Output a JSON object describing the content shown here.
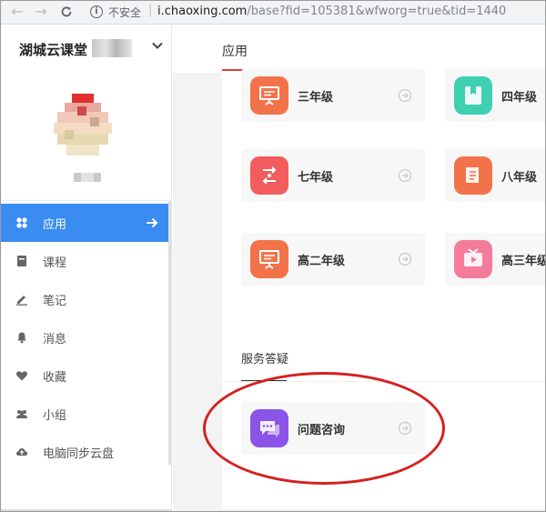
{
  "browser": {
    "security_label": "不安全",
    "separator": "|",
    "url_host": "i.chaoxing.com",
    "url_rest": "/base?fid=105381&wfworg=true&tid=1440"
  },
  "sidebar": {
    "title": "湖城云课堂",
    "menu": [
      {
        "label": "应用",
        "icon": "apps-icon",
        "active": true
      },
      {
        "label": "课程",
        "icon": "book-icon"
      },
      {
        "label": "笔记",
        "icon": "pen-icon"
      },
      {
        "label": "消息",
        "icon": "bell-icon"
      },
      {
        "label": "收藏",
        "icon": "heart-icon"
      },
      {
        "label": "小组",
        "icon": "group-icon"
      },
      {
        "label": "电脑同步云盘",
        "icon": "cloud-upload-icon"
      }
    ]
  },
  "main": {
    "tab_label": "应用",
    "apps": [
      {
        "label": "三年级",
        "icon": "presentation-icon",
        "color": "#f2734a"
      },
      {
        "label": "四年级",
        "icon": "book-bookmark-icon",
        "color": "#3fcfb1"
      },
      {
        "label": "七年级",
        "icon": "route-icon",
        "color": "#f25c5c"
      },
      {
        "label": "八年级",
        "icon": "scroll-icon",
        "color": "#f2734a"
      },
      {
        "label": "高二年级",
        "icon": "presentation-icon",
        "color": "#f2734a"
      },
      {
        "label": "高三年级",
        "icon": "tv-play-icon",
        "color": "#f47c9a"
      }
    ],
    "service": {
      "title": "服务答疑",
      "item_label": "问题咨询",
      "item_color": "#8a54e8"
    }
  },
  "colors": {
    "accent": "#3a8cf0",
    "tab_underline": "#e03c3c",
    "annotation": "#d62020"
  }
}
